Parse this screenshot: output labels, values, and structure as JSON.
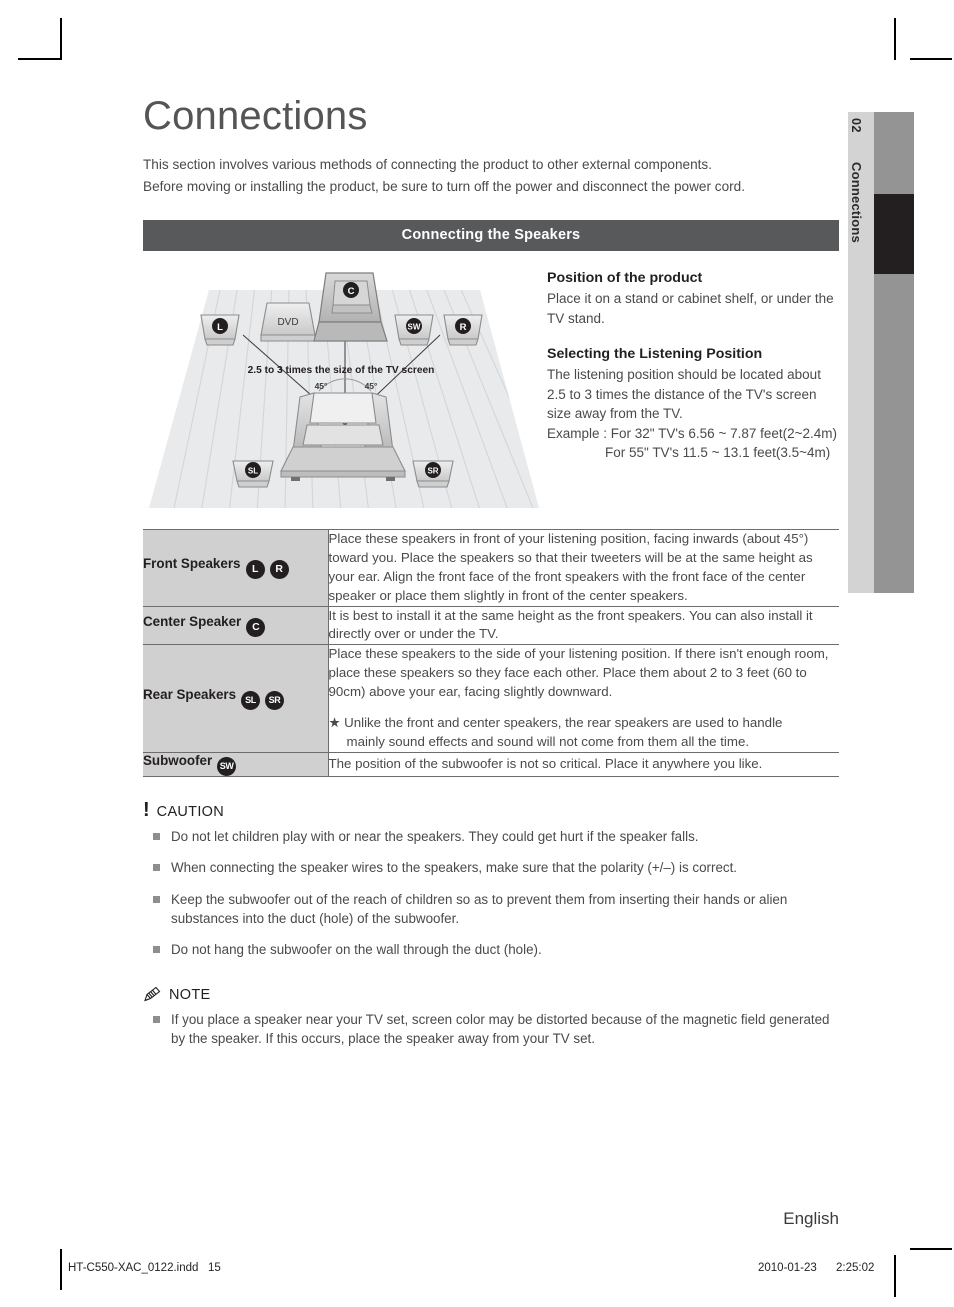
{
  "sidetab": {
    "number": "02",
    "name": "Connections"
  },
  "chapter": {
    "title": "Connections",
    "intro_line1": "This section involves various methods of connecting the product to other external components.",
    "intro_line2": "Before moving or installing the product, be sure to turn off the power and disconnect the power cord."
  },
  "section": {
    "bar_title": "Connecting the Speakers"
  },
  "diagram": {
    "caption": "2.5 to 3 times the size of the TV screen",
    "angle_left": "45°",
    "angle_right": "45°",
    "dvd_label": "DVD",
    "speakers": {
      "left": "L",
      "right": "R",
      "center": "C",
      "subwoofer": "SW",
      "surround_left": "SL",
      "surround_right": "SR"
    }
  },
  "side_text": {
    "heading1": "Position of the product",
    "body1": "Place it on a stand or cabinet shelf, or under the TV stand.",
    "heading2": "Selecting the Listening Position",
    "body2": "The listening position should be located about 2.5 to 3 times the distance of the TV's screen size away from the TV.",
    "example1": "Example : For 32\" TV's 6.56 ~ 7.87 feet(2~2.4m)",
    "example2": "For 55\" TV's 11.5 ~ 13.1 feet(3.5~4m)"
  },
  "table": {
    "rows": [
      {
        "label": "Front Speakers",
        "chips": [
          "L",
          "R"
        ],
        "description": "Place these speakers in front of your listening position, facing inwards (about 45°) toward you. Place the speakers so that their tweeters will be at the same height as your ear. Align the front face of the front speakers with the front face of the center speaker or place them slightly in front of the center speakers.",
        "note": "",
        "note_cont": ""
      },
      {
        "label": "Center Speaker",
        "chips": [
          "C"
        ],
        "description": "It is best to install it at the same height as the front speakers. You can also install it directly over or under the TV.",
        "note": "",
        "note_cont": ""
      },
      {
        "label": "Rear Speakers",
        "chips": [
          "SL",
          "SR"
        ],
        "description": "Place these speakers to the side of your listening position. If there isn't enough room, place these speakers so they face each other. Place them about 2 to 3 feet (60 to 90cm) above your ear, facing slightly downward.",
        "note": "★ Unlike the front and center speakers, the rear speakers are used to handle",
        "note_cont": "mainly sound effects and sound will not come from them all the time."
      },
      {
        "label": "Subwoofer",
        "chips": [
          "SW"
        ],
        "description": "The position of the subwoofer is not so critical. Place it anywhere you like.",
        "note": "",
        "note_cont": ""
      }
    ]
  },
  "caution": {
    "glyph": "!",
    "title": "CAUTION",
    "items": [
      "Do not let children play with or near the speakers. They could get hurt if the speaker falls.",
      "When connecting the speaker wires to the speakers, make sure that the polarity (+/–) is correct.",
      "Keep the subwoofer out of the reach of children so as to prevent them from inserting their hands or alien substances into the duct (hole) of the subwoofer.",
      "Do not hang the subwoofer on the wall through the duct (hole)."
    ]
  },
  "note": {
    "title": "NOTE",
    "items": [
      "If you place a speaker near your TV set, screen color may be distorted because of the magnetic field generated by the speaker. If this occurs, place the speaker away from your TV set."
    ]
  },
  "footer": {
    "language": "English",
    "file": "HT-C550-XAC_0122.indd   15",
    "print_stamp": "2010-01-23      2:25:02"
  }
}
